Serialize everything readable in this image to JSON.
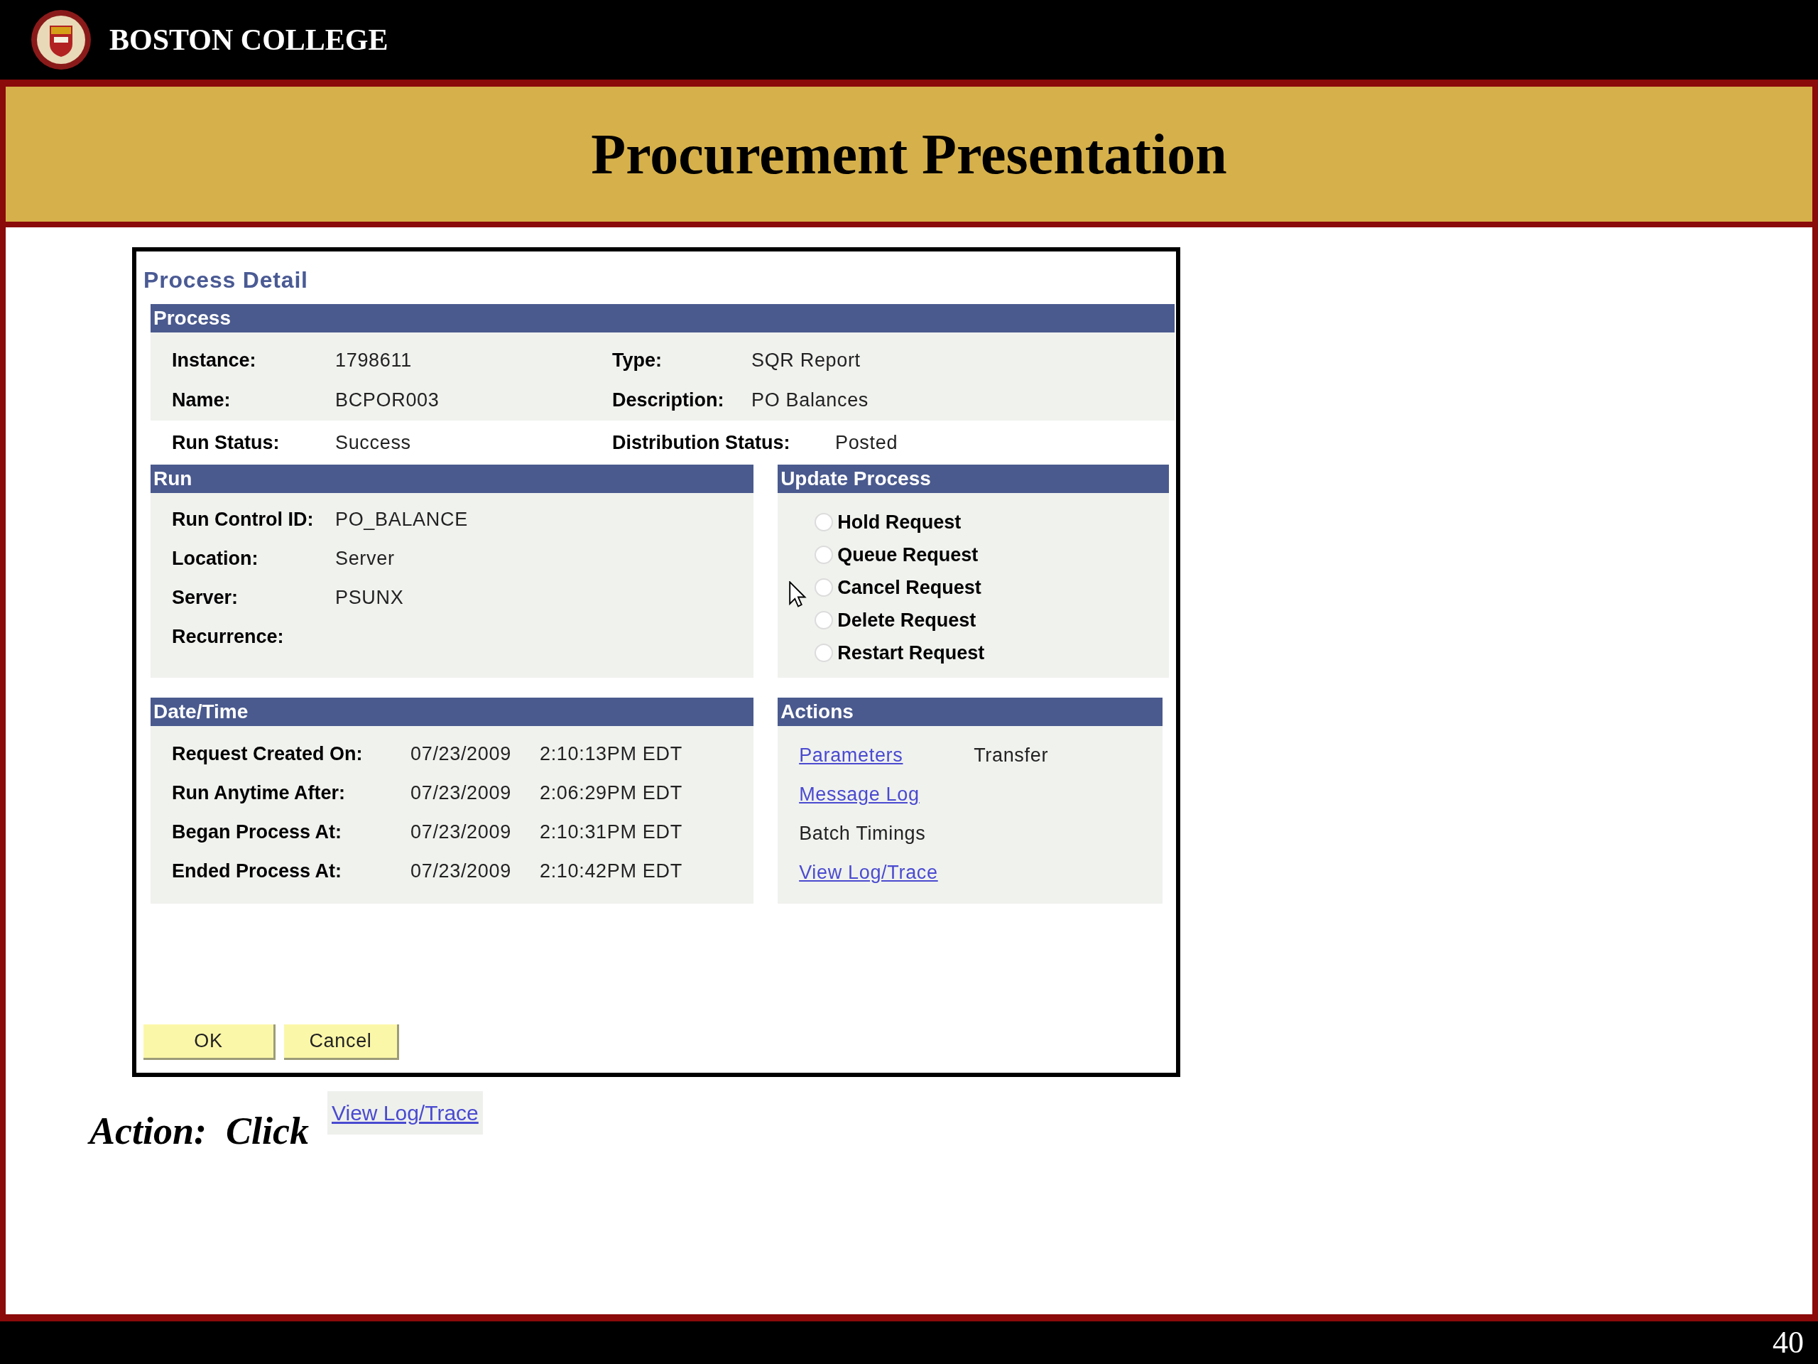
{
  "header": {
    "organization": "BOSTON COLLEGE"
  },
  "slide_title": "Procurement Presentation",
  "screenshot": {
    "page_title": "Process Detail",
    "process": {
      "heading": "Process",
      "rows": [
        [
          {
            "label": "Instance:",
            "value": "1798611"
          },
          {
            "label": "Type:",
            "value": "SQR Report"
          }
        ],
        [
          {
            "label": "Name:",
            "value": "BCPOR003"
          },
          {
            "label": "Description:",
            "value": "PO Balances"
          }
        ]
      ],
      "status_row": [
        {
          "label": "Run Status:",
          "value": "Success"
        },
        {
          "label": "Distribution Status:",
          "value": "Posted"
        }
      ]
    },
    "run": {
      "heading": "Run",
      "fields": [
        {
          "label": "Run Control ID:",
          "value": "PO_BALANCE"
        },
        {
          "label": "Location:",
          "value": "Server"
        },
        {
          "label": "Server:",
          "value": "PSUNX"
        },
        {
          "label": "Recurrence:"
        }
      ]
    },
    "update_process": {
      "heading": "Update Process",
      "options": [
        {
          "label": "Hold Request",
          "selected": false
        },
        {
          "label": "Queue Request",
          "selected": false
        },
        {
          "label": "Cancel Request",
          "selected": false
        },
        {
          "label": "Delete Request",
          "selected": false
        },
        {
          "label": "Restart Request",
          "selected": false
        }
      ]
    },
    "date_time": {
      "heading": "Date/Time",
      "fields": [
        {
          "label": "Request Created On:",
          "date": "07/23/2009",
          "time": "2:10:13PM EDT"
        },
        {
          "label": "Run Anytime After:",
          "date": "07/23/2009",
          "time": "2:06:29PM EDT"
        },
        {
          "label": "Began Process At:",
          "date": "07/23/2009",
          "time": "2:10:31PM EDT"
        },
        {
          "label": "Ended Process At:",
          "date": "07/23/2009",
          "time": "2:10:42PM EDT"
        }
      ]
    },
    "actions": {
      "heading": "Actions",
      "rows": [
        [
          {
            "text": "Parameters",
            "kind": "link"
          },
          {
            "text": "Transfer",
            "kind": "text"
          }
        ],
        [
          {
            "text": "Message Log",
            "kind": "link"
          }
        ],
        [
          {
            "text": "Batch Timings",
            "kind": "text"
          }
        ],
        [
          {
            "text": "View Log/Trace",
            "kind": "link"
          }
        ]
      ]
    },
    "buttons": [
      "OK",
      "Cancel"
    ]
  },
  "instruction": {
    "text": "Action:  Click",
    "link": "View Log/Trace"
  },
  "page_number": "40"
}
